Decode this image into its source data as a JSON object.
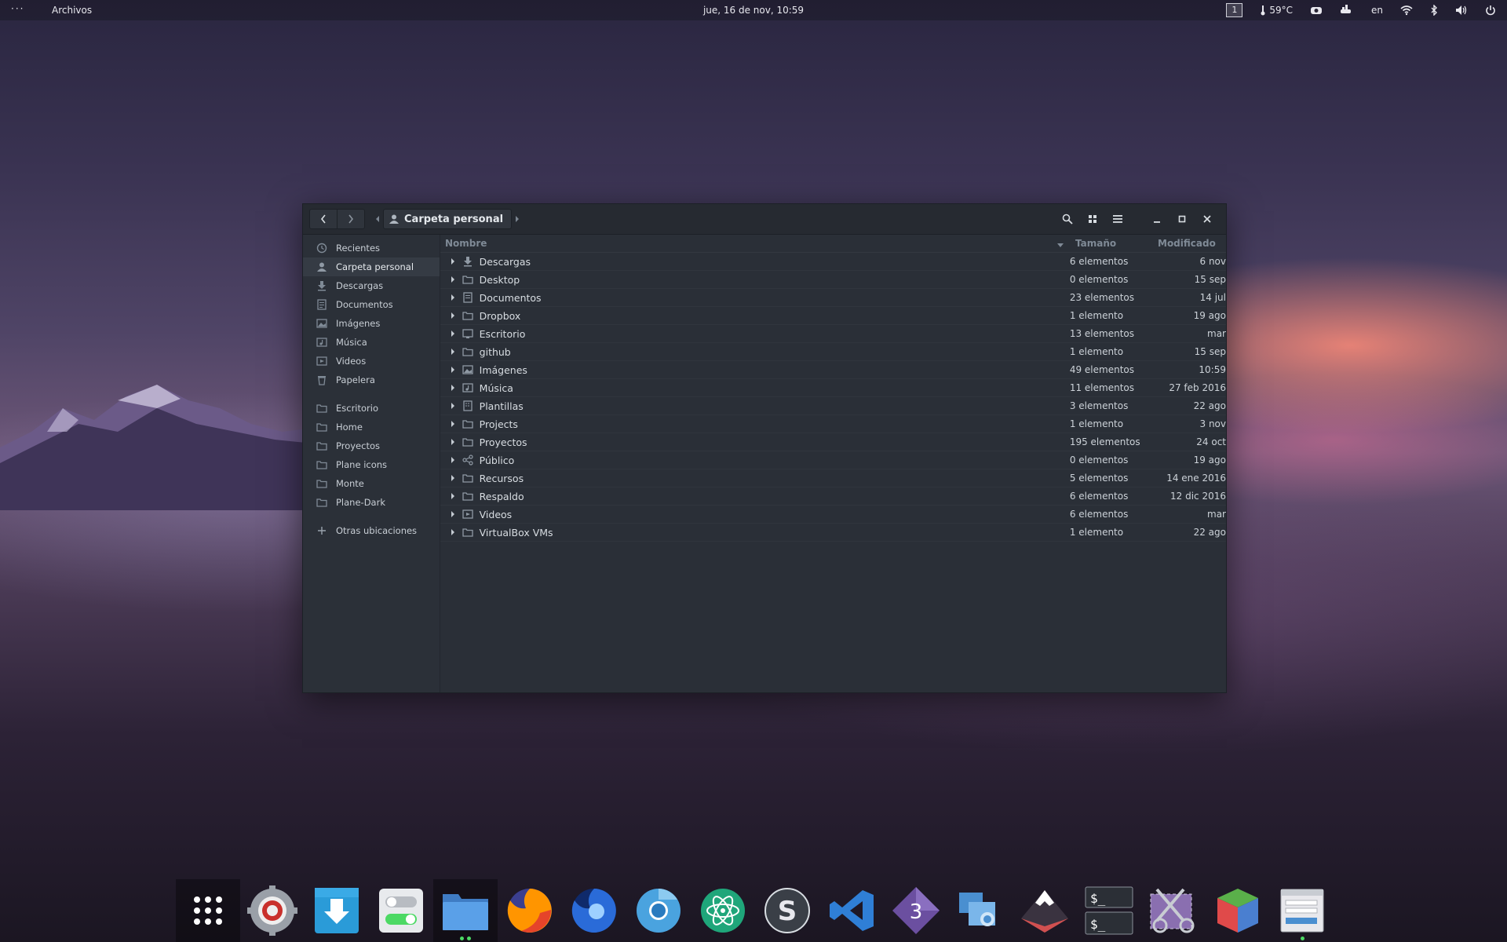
{
  "topbar": {
    "activities": "···",
    "app_name": "Archivos",
    "clock": "jue, 16 de nov, 10:59",
    "workspace": "1",
    "temperature": "59°C",
    "keyboard_layout": "en"
  },
  "window": {
    "breadcrumb": "Carpeta personal"
  },
  "sidebar": {
    "places": [
      {
        "label": "Recientes",
        "icon": "clock-icon"
      },
      {
        "label": "Carpeta personal",
        "icon": "user-icon",
        "active": true
      },
      {
        "label": "Descargas",
        "icon": "download-icon"
      },
      {
        "label": "Documentos",
        "icon": "document-icon"
      },
      {
        "label": "Imágenes",
        "icon": "image-icon"
      },
      {
        "label": "Música",
        "icon": "music-icon"
      },
      {
        "label": "Videos",
        "icon": "video-icon"
      },
      {
        "label": "Papelera",
        "icon": "trash-icon"
      }
    ],
    "bookmarks": [
      {
        "label": "Escritorio",
        "icon": "folder-icon"
      },
      {
        "label": "Home",
        "icon": "folder-icon"
      },
      {
        "label": "Proyectos",
        "icon": "folder-icon"
      },
      {
        "label": "Plane icons",
        "icon": "folder-icon"
      },
      {
        "label": "Monte",
        "icon": "folder-icon"
      },
      {
        "label": "Plane-Dark",
        "icon": "folder-icon"
      }
    ],
    "other_locations": "Otras ubicaciones"
  },
  "columns": {
    "name": "Nombre",
    "size": "Tamaño",
    "modified": "Modificado"
  },
  "files": [
    {
      "name": "Descargas",
      "size": "6 elementos",
      "modified": "6 nov",
      "icon": "download-folder-icon"
    },
    {
      "name": "Desktop",
      "size": "0 elementos",
      "modified": "15 sep",
      "icon": "folder-icon"
    },
    {
      "name": "Documentos",
      "size": "23 elementos",
      "modified": "14 jul",
      "icon": "document-folder-icon"
    },
    {
      "name": "Dropbox",
      "size": "1 elemento",
      "modified": "19 ago",
      "icon": "folder-icon"
    },
    {
      "name": "Escritorio",
      "size": "13 elementos",
      "modified": "mar",
      "icon": "desktop-folder-icon"
    },
    {
      "name": "github",
      "size": "1 elemento",
      "modified": "15 sep",
      "icon": "folder-icon"
    },
    {
      "name": "Imágenes",
      "size": "49 elementos",
      "modified": "10:59",
      "icon": "image-folder-icon"
    },
    {
      "name": "Música",
      "size": "11 elementos",
      "modified": "27 feb 2016",
      "icon": "music-folder-icon"
    },
    {
      "name": "Plantillas",
      "size": "3 elementos",
      "modified": "22 ago",
      "icon": "template-folder-icon"
    },
    {
      "name": "Projects",
      "size": "1 elemento",
      "modified": "3 nov",
      "icon": "folder-icon"
    },
    {
      "name": "Proyectos",
      "size": "195 elementos",
      "modified": "24 oct",
      "icon": "folder-icon"
    },
    {
      "name": "Público",
      "size": "0 elementos",
      "modified": "19 ago",
      "icon": "share-folder-icon"
    },
    {
      "name": "Recursos",
      "size": "5 elementos",
      "modified": "14 ene 2016",
      "icon": "folder-icon"
    },
    {
      "name": "Respaldo",
      "size": "6 elementos",
      "modified": "12 dic 2016",
      "icon": "folder-icon"
    },
    {
      "name": "Videos",
      "size": "6 elementos",
      "modified": "mar",
      "icon": "video-folder-icon"
    },
    {
      "name": "VirtualBox VMs",
      "size": "1 elemento",
      "modified": "22 ago",
      "icon": "folder-icon"
    }
  ],
  "dock": [
    {
      "name": "app-grid",
      "color": "#ffffff"
    },
    {
      "name": "settings",
      "color": "#c9302c"
    },
    {
      "name": "software-updater",
      "color": "#2a9bd8"
    },
    {
      "name": "tweaks",
      "color": "#4cd964"
    },
    {
      "name": "files",
      "color": "#4a90d9",
      "running": 2
    },
    {
      "name": "firefox",
      "color": "#ff9500"
    },
    {
      "name": "firefox-nightly",
      "color": "#2a6bd8"
    },
    {
      "name": "chromium",
      "color": "#4aa3df"
    },
    {
      "name": "atom",
      "color": "#1fa67a"
    },
    {
      "name": "sublime-text",
      "color": "#3a3f47"
    },
    {
      "name": "visual-studio-code",
      "color": "#2f7fd6"
    },
    {
      "name": "blender-3",
      "color": "#6b4fa0"
    },
    {
      "name": "window-manager",
      "color": "#4a8fd0"
    },
    {
      "name": "inkscape",
      "color": "#d05050"
    },
    {
      "name": "terminal",
      "color": "#2b2f36"
    },
    {
      "name": "screenshot",
      "color": "#8a6fb0"
    },
    {
      "name": "glade",
      "color": "#5ab04a"
    },
    {
      "name": "form-app",
      "color": "#e8e8ec",
      "running": 1
    }
  ]
}
